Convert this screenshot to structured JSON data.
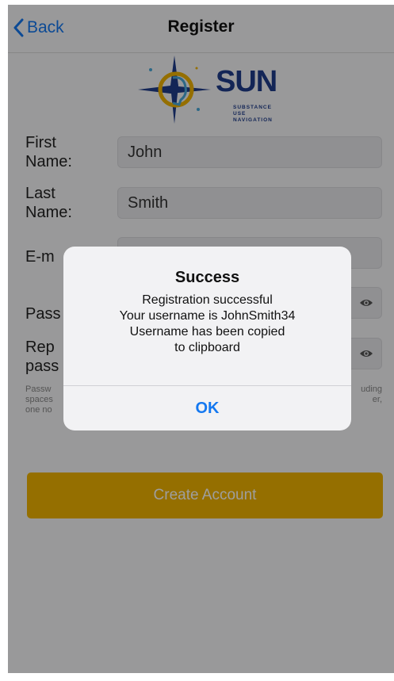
{
  "nav": {
    "back_label": "Back",
    "title": "Register"
  },
  "logo": {
    "text": "SUN",
    "tagline_line1": "SUBSTANCE",
    "tagline_line2": "USE NAVIGATION"
  },
  "form": {
    "first_name_label_1": "First",
    "first_name_label_2": "Name:",
    "first_name_value": "John",
    "last_name_label_1": "Last",
    "last_name_label_2": "Name:",
    "last_name_value": "Smith",
    "email_label_visible": "E-m",
    "password_label_visible": "Pass",
    "repeat_label_1_visible": "Rep",
    "repeat_label_2_visible": "pass",
    "hint_left_1": "Passw",
    "hint_left_2": "spaces",
    "hint_left_3": "one no",
    "hint_right_1": "uding",
    "hint_right_2": "er,"
  },
  "create_button_label": "Create Account",
  "alert": {
    "title": "Success",
    "line1": "Registration successful",
    "line2": "Your username is JohnSmith34",
    "line3": "Username has been copied",
    "line4": "to clipboard",
    "ok_label": "OK"
  },
  "colors": {
    "accent": "#1478f0",
    "button": "#f0b400",
    "brand": "#1f3d8c"
  }
}
